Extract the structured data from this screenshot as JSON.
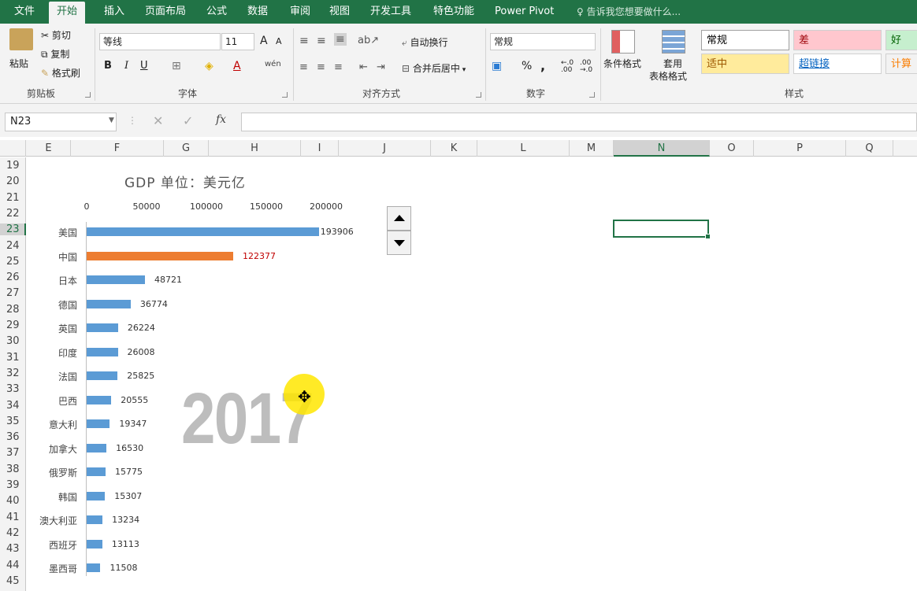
{
  "menu": {
    "tabs": [
      "文件",
      "开始",
      "插入",
      "页面布局",
      "公式",
      "数据",
      "审阅",
      "视图",
      "开发工具",
      "特色功能",
      "Power Pivot"
    ],
    "active": "开始",
    "tell_me": "告诉我您想要做什么..."
  },
  "ribbon": {
    "clipboard": {
      "paste": "粘贴",
      "cut": "剪切",
      "copy": "复制",
      "format_painter": "格式刷",
      "group": "剪贴板"
    },
    "font": {
      "name": "等线",
      "size": "11",
      "group": "字体",
      "bold": "B",
      "italic": "I",
      "underline": "U",
      "grow": "A",
      "shrink": "A",
      "phonetic": "wén"
    },
    "align": {
      "wrap": "自动换行",
      "merge": "合并后居中",
      "group": "对齐方式"
    },
    "number": {
      "format": "常规",
      "percent": "%",
      "comma": ",",
      "group": "数字",
      "inc_decimal": "←.0 .00",
      "dec_decimal": ".00 →.0"
    },
    "styles": {
      "conditional": "条件格式",
      "table_top": "套用",
      "table_bottom": "表格格式",
      "group": "样式",
      "cells": [
        {
          "label": "常规",
          "bg": "#ffffff",
          "fg": "#000000"
        },
        {
          "label": "差",
          "bg": "#ffc7ce",
          "fg": "#9c0006"
        },
        {
          "label": "好",
          "bg": "#c6efce",
          "fg": "#006100"
        },
        {
          "label": "适中",
          "bg": "#ffeb9c",
          "fg": "#9c5700"
        },
        {
          "label": "超链接",
          "bg": "#ffffff",
          "fg": "#0563c1"
        },
        {
          "label": "计算",
          "bg": "#f2f2f2",
          "fg": "#fa7d00"
        }
      ]
    }
  },
  "formula_bar": {
    "name_box": "N23",
    "fx": "fx",
    "value": ""
  },
  "columns": [
    "E",
    "F",
    "G",
    "H",
    "I",
    "J",
    "K",
    "L",
    "M",
    "N",
    "O",
    "P",
    "Q"
  ],
  "selected_column": "N",
  "rows": [
    "19",
    "20",
    "21",
    "22",
    "23",
    "24",
    "25",
    "26",
    "27",
    "28",
    "29",
    "30",
    "31",
    "32",
    "33",
    "34",
    "35",
    "36",
    "37",
    "38",
    "39",
    "40",
    "41",
    "42",
    "43",
    "44",
    "45"
  ],
  "selected_row": "23",
  "chart_data": {
    "type": "bar",
    "title": "GDP 单位：美元亿",
    "orientation": "horizontal",
    "xlim": [
      0,
      200000
    ],
    "x_ticks": [
      "0",
      "50000",
      "100000",
      "150000",
      "200000"
    ],
    "categories": [
      "美国",
      "中国",
      "日本",
      "德国",
      "英国",
      "印度",
      "法国",
      "巴西",
      "意大利",
      "加拿大",
      "俄罗斯",
      "韩国",
      "澳大利亚",
      "西班牙",
      "墨西哥"
    ],
    "values": [
      193906,
      122377,
      48721,
      36774,
      26224,
      26008,
      25825,
      20555,
      19347,
      16530,
      15775,
      15307,
      13234,
      13113,
      11508
    ],
    "highlight_index": 1,
    "colors": {
      "default": "#5b9bd5",
      "highlight": "#ed7d31",
      "highlight_label": "#c00000"
    },
    "year": "2017"
  }
}
